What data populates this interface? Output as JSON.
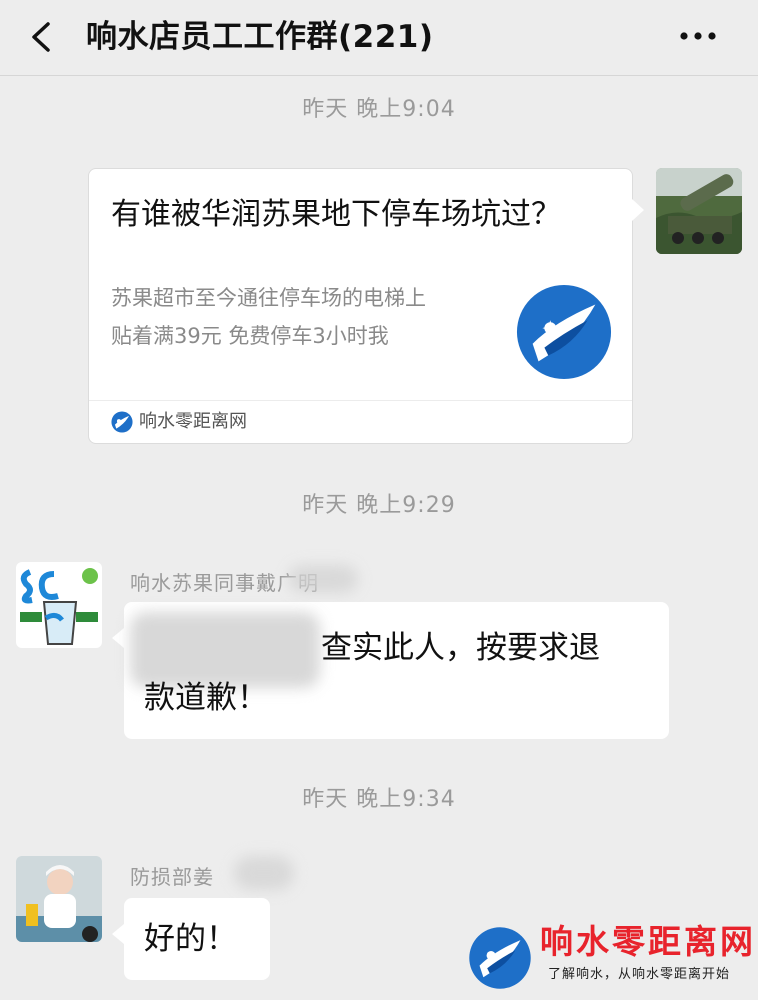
{
  "header": {
    "title": "响水店员工工作群(221)",
    "back_icon": "back-chevron-icon",
    "more_icon": "more-dots-icon"
  },
  "messages": [
    {
      "time": "昨天 晚上9:04",
      "type": "link-card",
      "side": "right",
      "avatar_icon": "missile-vehicle-avatar",
      "card": {
        "title": "有谁被华润苏果地下停车场坑过？",
        "desc_line1": "苏果超市至今通往停车场的电梯上",
        "desc_line2": "贴着满39元 免费停车3小时我",
        "source": "响水零距离网",
        "source_icon": "xiangshui-logo-icon"
      }
    },
    {
      "time": "昨天 晚上9:29",
      "type": "text",
      "side": "left",
      "sender": "响水苏果同事戴广明",
      "avatar_icon": "suguo-logo-avatar",
      "text_line1": "查实此人，按要求退",
      "text_line2": "款道歉！"
    },
    {
      "time": "昨天 晚上9:34",
      "type": "text",
      "side": "left",
      "sender": "防损部姜",
      "avatar_icon": "child-photo-avatar",
      "text": "好的！"
    }
  ],
  "watermark": {
    "title": "响水零距离网",
    "subtitle": "了解响水，从响水零距离开始",
    "logo_icon": "xiangshui-logo-icon"
  },
  "colors": {
    "background": "#ededed",
    "bubble": "#ffffff",
    "timestamp": "#9a9a9a",
    "logo_blue": "#1e6fc8",
    "watermark_red": "#e8232c"
  }
}
